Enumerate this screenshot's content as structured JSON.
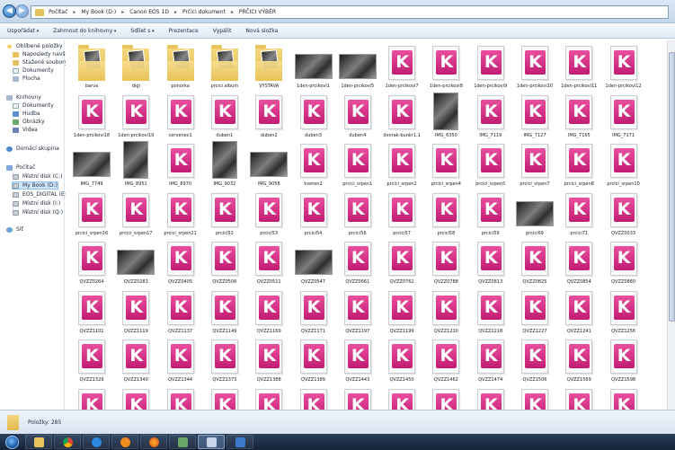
{
  "address": {
    "crumbs": [
      "Počítač",
      "My Book (D:)",
      "Canon EOS 1D",
      "Prčici dokument",
      "PRČICI VÝBĚR"
    ]
  },
  "toolbar": {
    "organize": "Uspořádat",
    "include": "Zahrnout do knihovny",
    "share": "Sdílet s",
    "slideshow": "Prezentace",
    "burn": "Vypálit",
    "new_folder": "Nová složka"
  },
  "nav": {
    "favorites": "Oblíbené položky",
    "recent": "Naposledy navštívené",
    "downloads": "Stažené soubory",
    "documents_fav": "Dokumenty",
    "desktop": "Plocha",
    "libraries": "Knihovny",
    "documents": "Dokumenty",
    "music": "Hudba",
    "pictures": "Obrázky",
    "videos": "Videa",
    "homegroup": "Domácí skupina",
    "computer": "Počítač",
    "drive_c": "Místní disk (C:)",
    "drive_d": "My Book (D:)",
    "drive_e": "EOS_DIGITAL (E:)",
    "drive_i": "Místní disk (I:)",
    "drive_q": "Místní disk (Q:)",
    "network": "Síť"
  },
  "items": [
    {
      "label": "barva",
      "kind": "folder"
    },
    {
      "label": "digi",
      "kind": "folder"
    },
    {
      "label": "ponorka",
      "kind": "folder"
    },
    {
      "label": "prcici album",
      "kind": "folder"
    },
    {
      "label": "VÝSTAVA",
      "kind": "folder"
    },
    {
      "label": "1den-prcikovi1",
      "kind": "photo-l"
    },
    {
      "label": "1den-prcikovi5",
      "kind": "photo-l"
    },
    {
      "label": "1den-prcikovi7",
      "kind": "k"
    },
    {
      "label": "1den-prcikovi8",
      "kind": "k"
    },
    {
      "label": "1den-prcikovi9",
      "kind": "k"
    },
    {
      "label": "1den-prcikovi10",
      "kind": "k"
    },
    {
      "label": "1den-prcikovi11",
      "kind": "k"
    },
    {
      "label": "1den-prcikovi12",
      "kind": "k"
    },
    {
      "label": "1den-prcikovi18",
      "kind": "k"
    },
    {
      "label": "1den-prcikovi19",
      "kind": "k"
    },
    {
      "label": "cervenec1",
      "kind": "k"
    },
    {
      "label": "duben1",
      "kind": "k"
    },
    {
      "label": "duben2",
      "kind": "k"
    },
    {
      "label": "duben3",
      "kind": "k"
    },
    {
      "label": "duben4",
      "kind": "k"
    },
    {
      "label": "dvorak-bunkr1.1",
      "kind": "k"
    },
    {
      "label": "IMG_6350",
      "kind": "photo-p"
    },
    {
      "label": "IMG_7119",
      "kind": "k"
    },
    {
      "label": "IMG_7127",
      "kind": "k"
    },
    {
      "label": "IMG_7165",
      "kind": "k"
    },
    {
      "label": "IMG_7171",
      "kind": "k"
    },
    {
      "label": "IMG_7749",
      "kind": "photo-l"
    },
    {
      "label": "IMG_8951",
      "kind": "photo-p"
    },
    {
      "label": "IMG_8970",
      "kind": "k"
    },
    {
      "label": "IMG_9032",
      "kind": "photo-p"
    },
    {
      "label": "IMG_9058",
      "kind": "photo-l"
    },
    {
      "label": "kveten2",
      "kind": "k"
    },
    {
      "label": "prcici_srpen1",
      "kind": "k"
    },
    {
      "label": "prcici_srpen2",
      "kind": "k"
    },
    {
      "label": "prcici_srpen4",
      "kind": "k"
    },
    {
      "label": "prcici_srpen5",
      "kind": "k"
    },
    {
      "label": "prcici_srpen7",
      "kind": "k"
    },
    {
      "label": "prcici_srpen8",
      "kind": "k"
    },
    {
      "label": "prcici_srpen10",
      "kind": "k"
    },
    {
      "label": "prcici_srpen16",
      "kind": "k"
    },
    {
      "label": "prcici_srpen17",
      "kind": "k"
    },
    {
      "label": "prcici_srpen21",
      "kind": "k"
    },
    {
      "label": "prcici52",
      "kind": "k"
    },
    {
      "label": "prcici53",
      "kind": "k"
    },
    {
      "label": "prcici54",
      "kind": "k"
    },
    {
      "label": "prcici56",
      "kind": "k"
    },
    {
      "label": "prcici57",
      "kind": "k"
    },
    {
      "label": "prcici58",
      "kind": "k"
    },
    {
      "label": "prcici59",
      "kind": "k"
    },
    {
      "label": "prcici69",
      "kind": "photo-l"
    },
    {
      "label": "prcici71",
      "kind": "k"
    },
    {
      "label": "QVZZ0033",
      "kind": "k"
    },
    {
      "label": "QVZZ0264",
      "kind": "k"
    },
    {
      "label": "QVZZ0283",
      "kind": "photo-l"
    },
    {
      "label": "QVZZ0405",
      "kind": "k"
    },
    {
      "label": "QVZZ0506",
      "kind": "k"
    },
    {
      "label": "QVZZ0511",
      "kind": "k"
    },
    {
      "label": "QVZZ0547",
      "kind": "photo-l"
    },
    {
      "label": "QVZZ0661",
      "kind": "k"
    },
    {
      "label": "QVZZ0762",
      "kind": "k"
    },
    {
      "label": "QVZZ0788",
      "kind": "k"
    },
    {
      "label": "QVZZ0813",
      "kind": "k"
    },
    {
      "label": "QVZZ0825",
      "kind": "k"
    },
    {
      "label": "QVZZ0854",
      "kind": "k"
    },
    {
      "label": "QVZZ0860",
      "kind": "k"
    },
    {
      "label": "QVZZ1101",
      "kind": "k"
    },
    {
      "label": "QVZZ1119",
      "kind": "k"
    },
    {
      "label": "QVZZ1137",
      "kind": "k"
    },
    {
      "label": "QVZZ1149",
      "kind": "k"
    },
    {
      "label": "QVZZ1169",
      "kind": "k"
    },
    {
      "label": "QVZZ1171",
      "kind": "k"
    },
    {
      "label": "QVZZ1197",
      "kind": "k"
    },
    {
      "label": "QVZZ1199",
      "kind": "k"
    },
    {
      "label": "QVZZ1210",
      "kind": "k"
    },
    {
      "label": "QVZZ1218",
      "kind": "k"
    },
    {
      "label": "QVZZ1227",
      "kind": "k"
    },
    {
      "label": "QVZZ1241",
      "kind": "k"
    },
    {
      "label": "QVZZ1256",
      "kind": "k"
    },
    {
      "label": "QVZZ1329",
      "kind": "k"
    },
    {
      "label": "QVZZ1340",
      "kind": "k"
    },
    {
      "label": "QVZZ1344",
      "kind": "k"
    },
    {
      "label": "QVZZ1373",
      "kind": "k"
    },
    {
      "label": "QVZZ1388",
      "kind": "k"
    },
    {
      "label": "QVZZ1389",
      "kind": "k"
    },
    {
      "label": "QVZZ1443",
      "kind": "k"
    },
    {
      "label": "QVZZ1450",
      "kind": "k"
    },
    {
      "label": "QVZZ1462",
      "kind": "k"
    },
    {
      "label": "QVZZ1474",
      "kind": "k"
    },
    {
      "label": "QVZZ1506",
      "kind": "k"
    },
    {
      "label": "QVZZ1569",
      "kind": "k"
    },
    {
      "label": "QVZZ1598",
      "kind": "k"
    },
    {
      "label": "",
      "kind": "k"
    },
    {
      "label": "",
      "kind": "k"
    },
    {
      "label": "",
      "kind": "k"
    },
    {
      "label": "",
      "kind": "k"
    },
    {
      "label": "",
      "kind": "k"
    },
    {
      "label": "",
      "kind": "k"
    },
    {
      "label": "",
      "kind": "k"
    },
    {
      "label": "",
      "kind": "k"
    },
    {
      "label": "",
      "kind": "k"
    },
    {
      "label": "",
      "kind": "k"
    },
    {
      "label": "",
      "kind": "k"
    },
    {
      "label": "",
      "kind": "k"
    },
    {
      "label": "",
      "kind": "k"
    }
  ],
  "k_glyph": "K",
  "status": {
    "count": "Položky: 285"
  },
  "taskbar": {
    "apps": [
      "folder-icon",
      "chrome-icon",
      "ie-icon",
      "media-player-icon",
      "firefox-icon",
      "app-icon",
      "app-icon",
      "app-icon"
    ]
  }
}
